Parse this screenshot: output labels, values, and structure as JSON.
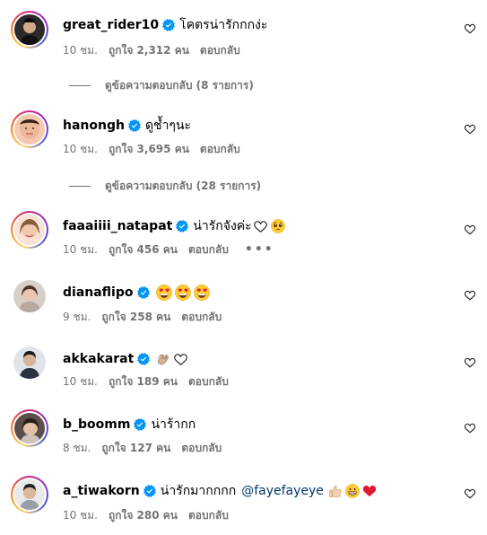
{
  "colors": {
    "text": "#000000",
    "meta": "#737373",
    "verified_blue": "#0095f6",
    "mention": "#00376b"
  },
  "comments": [
    {
      "username": "great_rider10",
      "text": "โคตรน่ารักกกง่ะ",
      "time": "10 ชม.",
      "likes": "ถูกใจ 2,312 คน",
      "reply": "ตอบกลับ",
      "view_replies": "ดูข้อความตอบกลับ (8 รายการ)",
      "story_ring": true,
      "avatar_icon": "avatar-photo"
    },
    {
      "username": "hanongh",
      "text": "ดูช้ำๆนะ",
      "time": "10 ชม.",
      "likes": "ถูกใจ 3,695 คน",
      "reply": "ตอบกลับ",
      "view_replies": "ดูข้อความตอบกลับ (28 รายการ)",
      "story_ring": true,
      "avatar_icon": "avatar-photo"
    },
    {
      "username": "faaaiiii_natapat",
      "text": "น่ารักจังค่ะ",
      "emojis": [
        "white-heart-icon",
        "pleading-face-icon"
      ],
      "time": "10 ชม.",
      "likes": "ถูกใจ 456 คน",
      "reply": "ตอบกลับ",
      "more": "•••",
      "story_ring": true,
      "avatar_icon": "avatar-photo"
    },
    {
      "username": "dianaflipo",
      "text": "",
      "emojis": [
        "heart-eyes-icon",
        "heart-eyes-icon",
        "heart-eyes-icon"
      ],
      "time": "9 ชม.",
      "likes": "ถูกใจ 258 คน",
      "reply": "ตอบกลับ",
      "story_ring": false,
      "avatar_icon": "avatar-photo"
    },
    {
      "username": "akkakarat",
      "text": "",
      "emojis": [
        "clapping-hands-icon",
        "white-heart-icon"
      ],
      "time": "10 ชม.",
      "likes": "ถูกใจ 189 คน",
      "reply": "ตอบกลับ",
      "story_ring": false,
      "avatar_icon": "avatar-photo"
    },
    {
      "username": "b_boomm",
      "text": "น่าร้ากก",
      "time": "8 ชม.",
      "likes": "ถูกใจ 127 คน",
      "reply": "ตอบกลับ",
      "story_ring": true,
      "avatar_icon": "avatar-photo"
    },
    {
      "username": "a_tiwakorn",
      "text": "น่ารักมากกกก",
      "mention": "@fayefayeye",
      "emojis": [
        "thumbs-up-icon",
        "grinning-face-icon",
        "red-heart-icon"
      ],
      "time": "10 ชม.",
      "likes": "ถูกใจ 280 คน",
      "reply": "ตอบกลับ",
      "story_ring": true,
      "avatar_icon": "avatar-photo"
    }
  ]
}
